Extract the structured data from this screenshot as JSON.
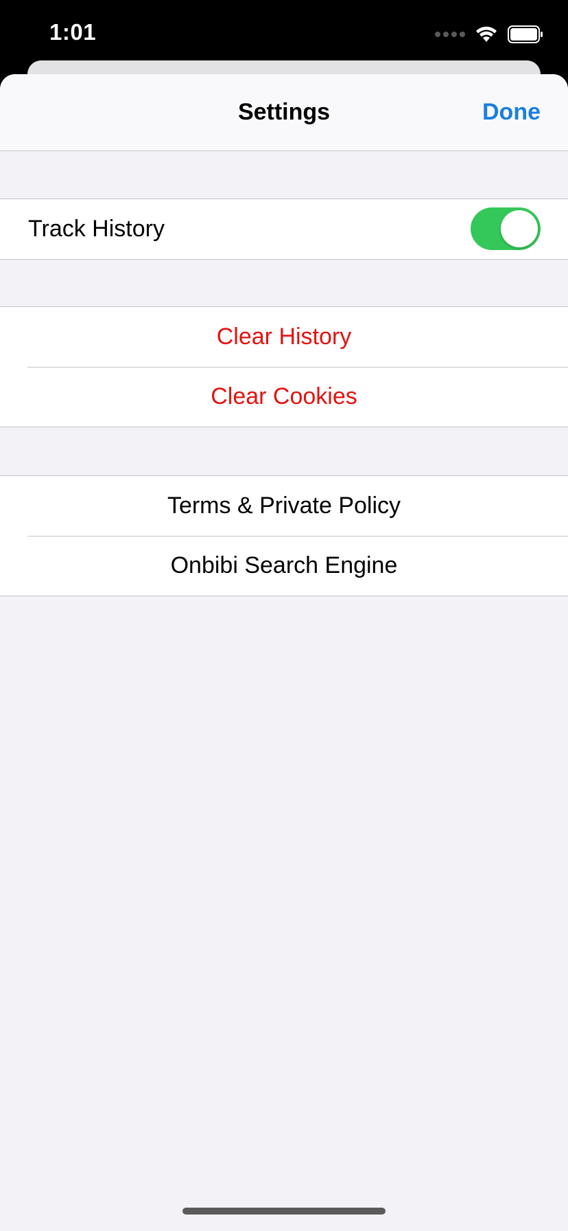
{
  "status_bar": {
    "time": "1:01",
    "icons": [
      "cellular-dots-icon",
      "wifi-icon",
      "battery-icon"
    ]
  },
  "nav": {
    "title": "Settings",
    "done_label": "Done"
  },
  "settings": {
    "track_history": {
      "label": "Track History",
      "enabled": true
    },
    "actions": [
      {
        "label": "Clear History"
      },
      {
        "label": "Clear Cookies"
      }
    ],
    "links": [
      {
        "label": "Terms & Private Policy"
      },
      {
        "label": "Onbibi Search Engine"
      }
    ]
  },
  "colors": {
    "accent": "#1a7fe0",
    "destructive": "#e3130f",
    "toggle_on": "#34c759",
    "background": "#f2f2f7"
  }
}
